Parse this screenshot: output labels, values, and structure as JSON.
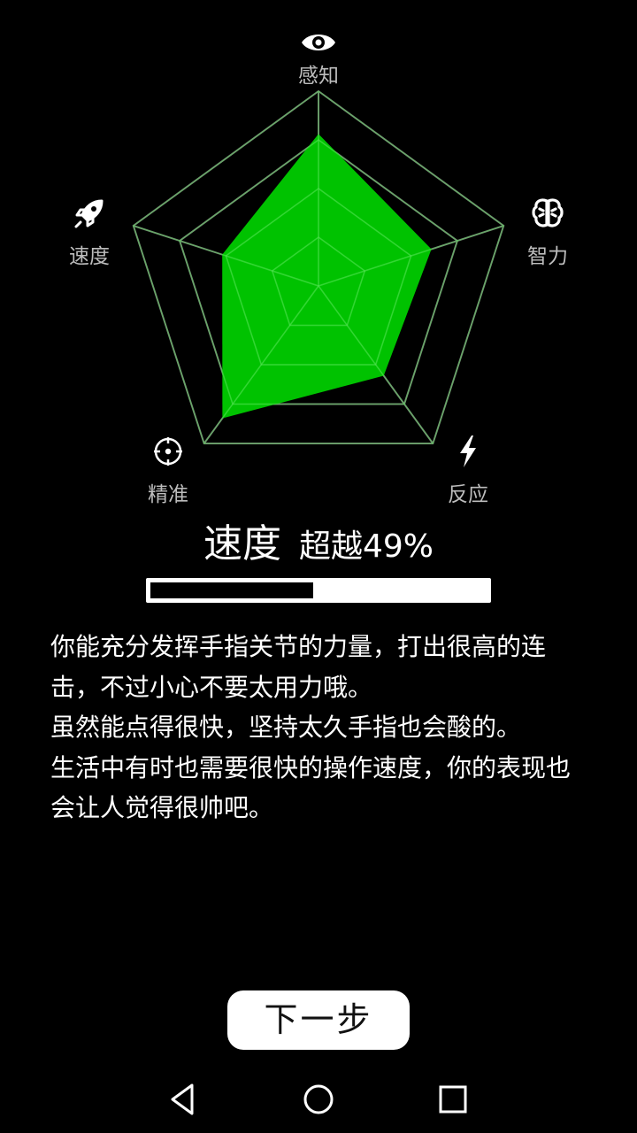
{
  "radar": {
    "axes": [
      {
        "key": "perception",
        "label": "感知",
        "icon": "eye-icon",
        "value": 0.78
      },
      {
        "key": "intelligence",
        "label": "智力",
        "icon": "brain-icon",
        "value": 0.61
      },
      {
        "key": "reaction",
        "label": "反应",
        "icon": "lightning-icon",
        "value": 0.57
      },
      {
        "key": "precision",
        "label": "精准",
        "icon": "crosshair-icon",
        "value": 0.84
      },
      {
        "key": "speed",
        "label": "速度",
        "icon": "rocket-icon",
        "value": 0.52
      }
    ],
    "fill_color": "#00cc00",
    "grid_color": "#6e6e6e",
    "grid_levels": 4
  },
  "result": {
    "title": "速度",
    "rank_text": "超越49%",
    "progress": 0.49
  },
  "description": {
    "paragraphs": [
      "你能充分发挥手指关节的力量，打出很高的连击，不过小心不要太用力哦。",
      "虽然能点得很快，坚持太久手指也会酸的。",
      "生活中有时也需要很快的操作速度，你的表现也会让人觉得很帅吧。"
    ]
  },
  "next_button": {
    "label": "下一步"
  },
  "nav_bar": {
    "back": "back-triangle-icon",
    "home": "home-circle-icon",
    "recents": "recents-square-icon"
  }
}
